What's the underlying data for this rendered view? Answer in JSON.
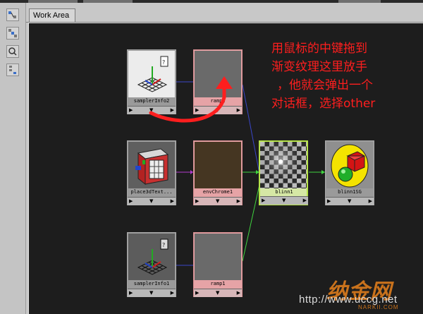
{
  "tabs": [
    {
      "label": "Work Area",
      "active": true
    }
  ],
  "toolbar": {
    "buttons": [
      "graph-up-icon",
      "graph-both-icon",
      "clear-graph-icon",
      "rearrange-graph-icon"
    ]
  },
  "nodes": [
    {
      "id": "samplerInfo2",
      "label": "samplerInfo2",
      "type": "samplerInfo",
      "color": "#9a9a9a"
    },
    {
      "id": "ramp2",
      "label": "ramp2",
      "type": "ramp",
      "color": "#e6a3a6"
    },
    {
      "id": "place3dTexture",
      "label": "place3dText...",
      "type": "place3dTexture",
      "color": "#9a9a9a"
    },
    {
      "id": "envChrome1",
      "label": "envChrome1",
      "type": "envChrome",
      "color": "#e6a3a6"
    },
    {
      "id": "blinn1",
      "label": "blinn1",
      "type": "blinn",
      "color": "#d6e8a5",
      "selected": true
    },
    {
      "id": "blinn1SG",
      "label": "blinn1SG",
      "type": "shadingGroup",
      "color": "#9a9a9a"
    },
    {
      "id": "samplerInfo1",
      "label": "samplerInfo1",
      "type": "samplerInfo",
      "color": "#9a9a9a"
    },
    {
      "id": "ramp1",
      "label": "ramp1",
      "type": "ramp",
      "color": "#e6a3a6"
    }
  ],
  "ports": {
    "left": "▶",
    "middle": "▼",
    "right": "▶"
  },
  "annotation": {
    "lines": [
      "用鼠标的中键拖到",
      "渐变纹理这里放手",
      "，他就会弹出一个",
      "对话框，选择other"
    ],
    "color": "#ff1e1e"
  },
  "watermark": {
    "url": "http://www.uccg.net",
    "logo": "纳金网",
    "sub": "NARKII.COM"
  },
  "colors": {
    "canvas": "#1d1d1d",
    "connection_blue": "#3a46c8",
    "connection_purple": "#b23ad0",
    "connection_green": "#3fd23f",
    "arrow_red": "#ff1e1e"
  }
}
